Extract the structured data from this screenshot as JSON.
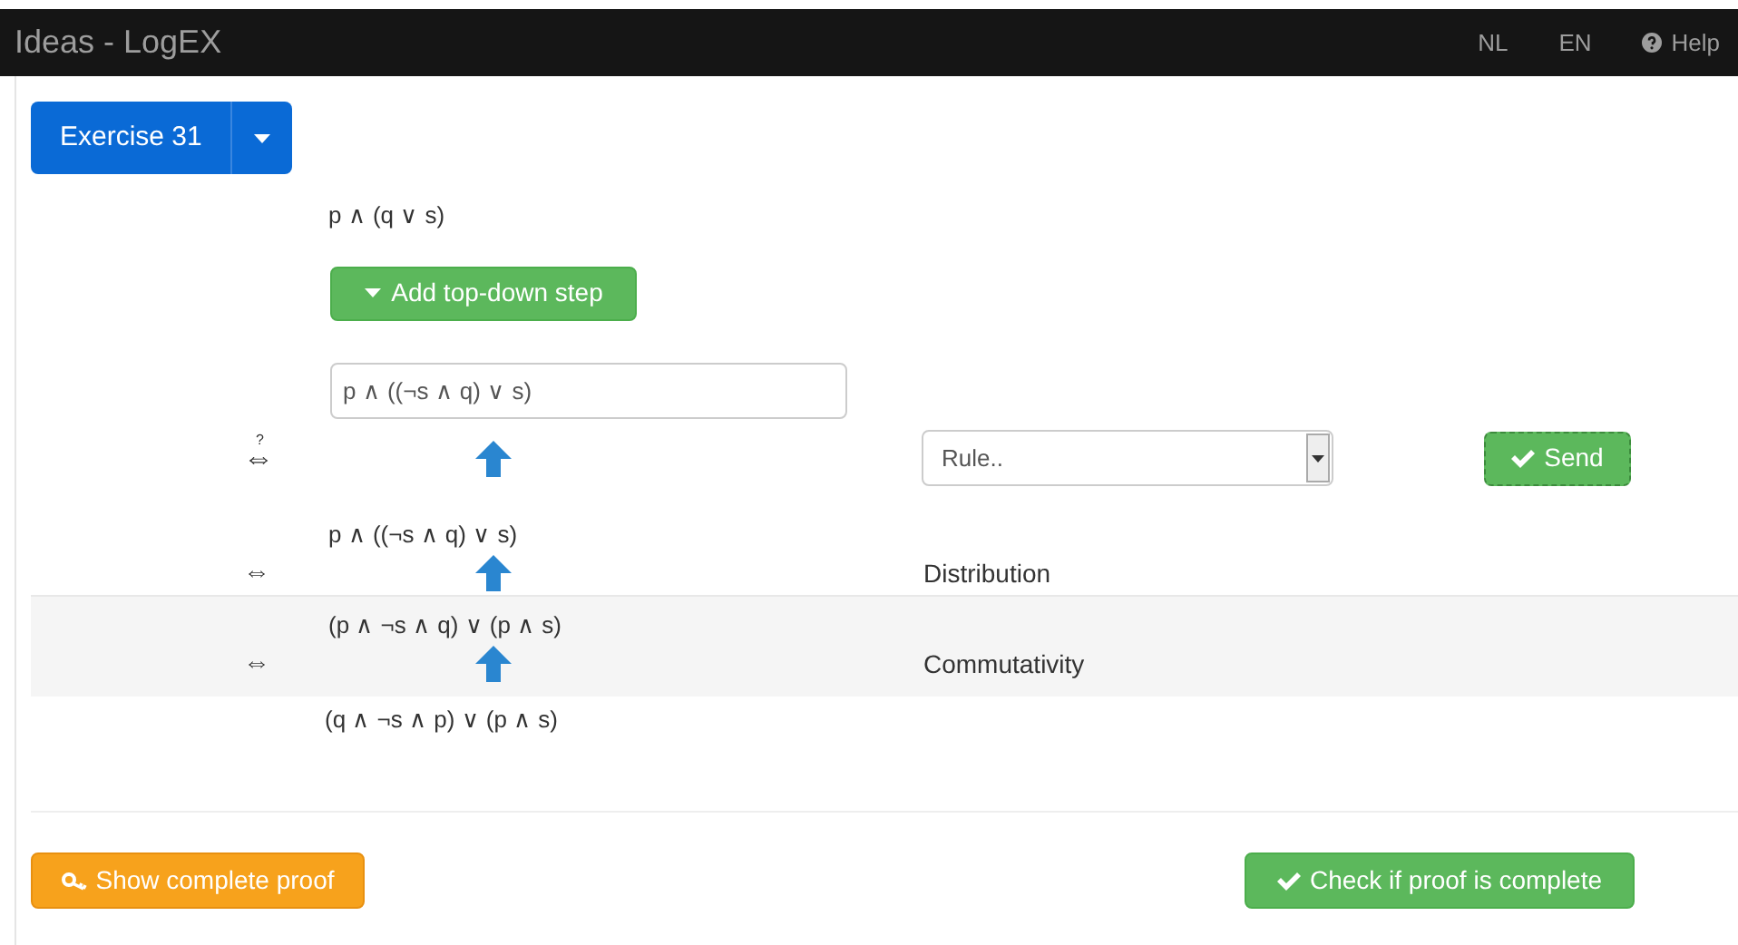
{
  "navbar": {
    "title": "Ideas - LogEX",
    "links": [
      {
        "label": "NL",
        "kind": "plain"
      },
      {
        "label": "EN",
        "kind": "plain"
      },
      {
        "label": "Help",
        "kind": "help"
      }
    ]
  },
  "exercise_button": {
    "label": "Exercise 31"
  },
  "start_term": "p ∧ (q ∨ s)",
  "add_step_button": "Add top-down step",
  "new_step": {
    "value": "p ∧ ((¬s ∧ q) ∨ s)",
    "relation": "⇔",
    "relation_mark": "?",
    "rule_select": {
      "placeholder": "Rule.."
    },
    "send_button": "Send"
  },
  "steps": [
    {
      "term": "p ∧ ((¬s ∧ q) ∨ s)",
      "relation": "⇔",
      "rule": "Distribution",
      "highlighted": false
    },
    {
      "term": "(p ∧ ¬s ∧ q) ∨ (p ∧ s)",
      "relation": "⇔",
      "rule": "Commutativity",
      "highlighted": true
    }
  ],
  "final_term": "(q ∧ ¬s ∧ p) ∨ (p ∧ s)",
  "show_proof_button": "Show complete proof",
  "check_button": "Check if proof is complete"
}
